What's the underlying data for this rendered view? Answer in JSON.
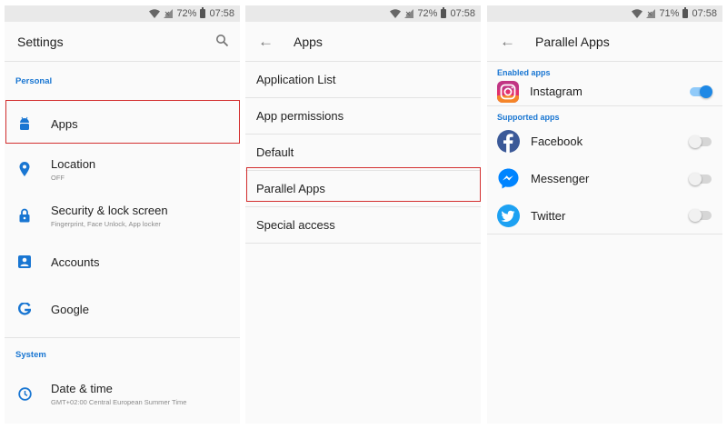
{
  "colors": {
    "accent": "#1976d2",
    "highlight": "#d32f2f"
  },
  "panel1": {
    "status": {
      "battery": "72%",
      "time": "07:58"
    },
    "title": "Settings",
    "section_personal": "Personal",
    "section_system": "System",
    "items": [
      {
        "title": "Apps",
        "subtitle": "",
        "icon": "android-icon"
      },
      {
        "title": "Location",
        "subtitle": "OFF",
        "icon": "location-pin-icon"
      },
      {
        "title": "Security & lock screen",
        "subtitle": "Fingerprint, Face Unlock, App locker",
        "icon": "lock-icon"
      },
      {
        "title": "Accounts",
        "subtitle": "",
        "icon": "account-icon"
      },
      {
        "title": "Google",
        "subtitle": "",
        "icon": "google-icon"
      },
      {
        "title": "Date & time",
        "subtitle": "GMT+02:00 Central European Summer Time",
        "icon": "clock-icon"
      }
    ]
  },
  "panel2": {
    "status": {
      "battery": "72%",
      "time": "07:58"
    },
    "title": "Apps",
    "items": [
      "Application List",
      "App permissions",
      "Default",
      "Parallel Apps",
      "Special access"
    ]
  },
  "panel3": {
    "status": {
      "battery": "71%",
      "time": "07:58"
    },
    "title": "Parallel Apps",
    "section_enabled": "Enabled apps",
    "section_supported": "Supported apps",
    "enabled": [
      {
        "name": "Instagram",
        "icon": "instagram-icon",
        "toggle": "on"
      }
    ],
    "supported": [
      {
        "name": "Facebook",
        "icon": "facebook-icon",
        "toggle": "off"
      },
      {
        "name": "Messenger",
        "icon": "messenger-icon",
        "toggle": "off"
      },
      {
        "name": "Twitter",
        "icon": "twitter-icon",
        "toggle": "off"
      }
    ]
  }
}
